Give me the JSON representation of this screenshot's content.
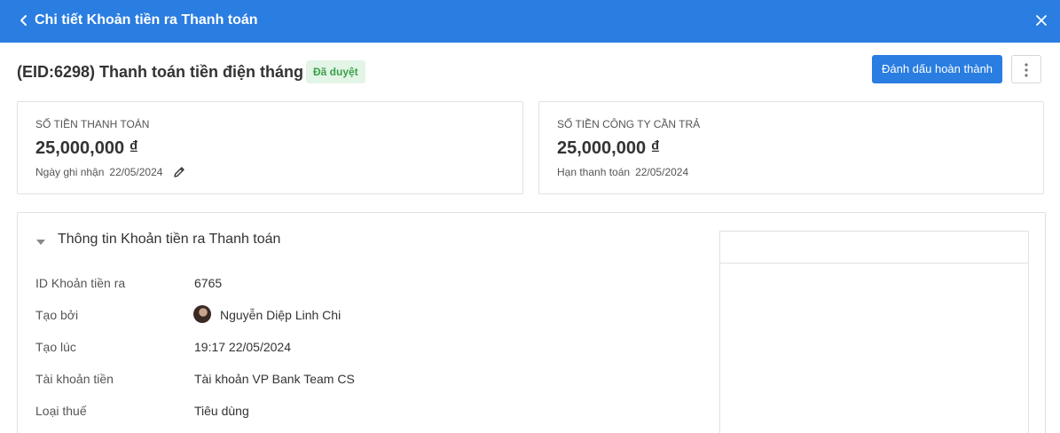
{
  "header": {
    "title": "Chi tiết Khoản tiền ra Thanh toán",
    "back_icon": "chevron-left-icon",
    "close_icon": "close-icon"
  },
  "record": {
    "title": "(EID:6298) Thanh toán tiền điện tháng 4",
    "status": "Đã duyệt",
    "status_color": "#3aa14b"
  },
  "actions": {
    "mark_complete_label": "Đánh dấu hoàn thành",
    "more_icon": "more-vertical-icon"
  },
  "summary": {
    "payment": {
      "label": "SỐ TIỀN THANH TOÁN",
      "amount": "25,000,000 ₫",
      "sub_label": "Ngày ghi nhận",
      "sub_value": "22/05/2024"
    },
    "company_due": {
      "label": "SỐ TIỀN CÔNG TY CẦN TRẢ",
      "amount": "25,000,000 ₫",
      "sub_label": "Hạn thanh toán",
      "sub_value": "22/05/2024"
    }
  },
  "info": {
    "section_title": "Thông tin Khoản tiền ra Thanh toán",
    "rows": [
      {
        "label": "ID Khoản tiền ra",
        "value": "6765"
      },
      {
        "label": "Tạo bởi",
        "value": "Nguyễn Diệp Linh Chi"
      },
      {
        "label": "Tạo lúc",
        "value": "19:17 22/05/2024"
      },
      {
        "label": "Tài khoản tiền",
        "value": "Tài khoản VP Bank Team CS"
      },
      {
        "label": "Loại thuế",
        "value": "Tiêu dùng"
      }
    ]
  },
  "colors": {
    "primary": "#2a7de1",
    "badge_bg": "#e3f5e6"
  }
}
